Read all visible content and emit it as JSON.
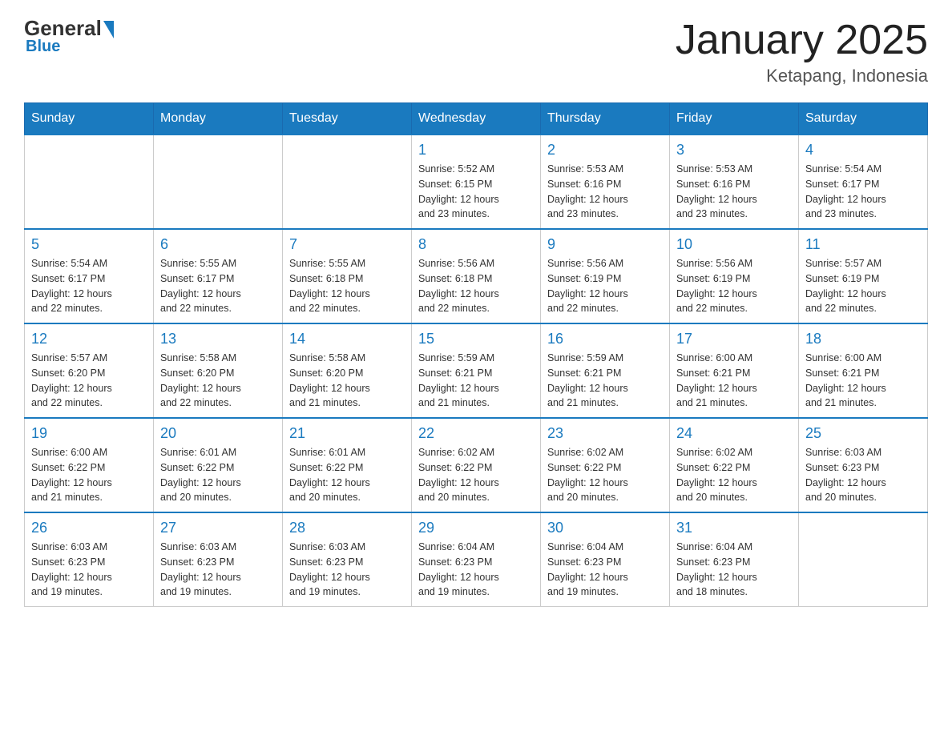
{
  "header": {
    "logo": {
      "text_general": "General",
      "text_blue": "Blue"
    },
    "title": "January 2025",
    "location": "Ketapang, Indonesia"
  },
  "weekdays": [
    "Sunday",
    "Monday",
    "Tuesday",
    "Wednesday",
    "Thursday",
    "Friday",
    "Saturday"
  ],
  "weeks": [
    [
      {
        "day": "",
        "info": ""
      },
      {
        "day": "",
        "info": ""
      },
      {
        "day": "",
        "info": ""
      },
      {
        "day": "1",
        "info": "Sunrise: 5:52 AM\nSunset: 6:15 PM\nDaylight: 12 hours\nand 23 minutes."
      },
      {
        "day": "2",
        "info": "Sunrise: 5:53 AM\nSunset: 6:16 PM\nDaylight: 12 hours\nand 23 minutes."
      },
      {
        "day": "3",
        "info": "Sunrise: 5:53 AM\nSunset: 6:16 PM\nDaylight: 12 hours\nand 23 minutes."
      },
      {
        "day": "4",
        "info": "Sunrise: 5:54 AM\nSunset: 6:17 PM\nDaylight: 12 hours\nand 23 minutes."
      }
    ],
    [
      {
        "day": "5",
        "info": "Sunrise: 5:54 AM\nSunset: 6:17 PM\nDaylight: 12 hours\nand 22 minutes."
      },
      {
        "day": "6",
        "info": "Sunrise: 5:55 AM\nSunset: 6:17 PM\nDaylight: 12 hours\nand 22 minutes."
      },
      {
        "day": "7",
        "info": "Sunrise: 5:55 AM\nSunset: 6:18 PM\nDaylight: 12 hours\nand 22 minutes."
      },
      {
        "day": "8",
        "info": "Sunrise: 5:56 AM\nSunset: 6:18 PM\nDaylight: 12 hours\nand 22 minutes."
      },
      {
        "day": "9",
        "info": "Sunrise: 5:56 AM\nSunset: 6:19 PM\nDaylight: 12 hours\nand 22 minutes."
      },
      {
        "day": "10",
        "info": "Sunrise: 5:56 AM\nSunset: 6:19 PM\nDaylight: 12 hours\nand 22 minutes."
      },
      {
        "day": "11",
        "info": "Sunrise: 5:57 AM\nSunset: 6:19 PM\nDaylight: 12 hours\nand 22 minutes."
      }
    ],
    [
      {
        "day": "12",
        "info": "Sunrise: 5:57 AM\nSunset: 6:20 PM\nDaylight: 12 hours\nand 22 minutes."
      },
      {
        "day": "13",
        "info": "Sunrise: 5:58 AM\nSunset: 6:20 PM\nDaylight: 12 hours\nand 22 minutes."
      },
      {
        "day": "14",
        "info": "Sunrise: 5:58 AM\nSunset: 6:20 PM\nDaylight: 12 hours\nand 21 minutes."
      },
      {
        "day": "15",
        "info": "Sunrise: 5:59 AM\nSunset: 6:21 PM\nDaylight: 12 hours\nand 21 minutes."
      },
      {
        "day": "16",
        "info": "Sunrise: 5:59 AM\nSunset: 6:21 PM\nDaylight: 12 hours\nand 21 minutes."
      },
      {
        "day": "17",
        "info": "Sunrise: 6:00 AM\nSunset: 6:21 PM\nDaylight: 12 hours\nand 21 minutes."
      },
      {
        "day": "18",
        "info": "Sunrise: 6:00 AM\nSunset: 6:21 PM\nDaylight: 12 hours\nand 21 minutes."
      }
    ],
    [
      {
        "day": "19",
        "info": "Sunrise: 6:00 AM\nSunset: 6:22 PM\nDaylight: 12 hours\nand 21 minutes."
      },
      {
        "day": "20",
        "info": "Sunrise: 6:01 AM\nSunset: 6:22 PM\nDaylight: 12 hours\nand 20 minutes."
      },
      {
        "day": "21",
        "info": "Sunrise: 6:01 AM\nSunset: 6:22 PM\nDaylight: 12 hours\nand 20 minutes."
      },
      {
        "day": "22",
        "info": "Sunrise: 6:02 AM\nSunset: 6:22 PM\nDaylight: 12 hours\nand 20 minutes."
      },
      {
        "day": "23",
        "info": "Sunrise: 6:02 AM\nSunset: 6:22 PM\nDaylight: 12 hours\nand 20 minutes."
      },
      {
        "day": "24",
        "info": "Sunrise: 6:02 AM\nSunset: 6:22 PM\nDaylight: 12 hours\nand 20 minutes."
      },
      {
        "day": "25",
        "info": "Sunrise: 6:03 AM\nSunset: 6:23 PM\nDaylight: 12 hours\nand 20 minutes."
      }
    ],
    [
      {
        "day": "26",
        "info": "Sunrise: 6:03 AM\nSunset: 6:23 PM\nDaylight: 12 hours\nand 19 minutes."
      },
      {
        "day": "27",
        "info": "Sunrise: 6:03 AM\nSunset: 6:23 PM\nDaylight: 12 hours\nand 19 minutes."
      },
      {
        "day": "28",
        "info": "Sunrise: 6:03 AM\nSunset: 6:23 PM\nDaylight: 12 hours\nand 19 minutes."
      },
      {
        "day": "29",
        "info": "Sunrise: 6:04 AM\nSunset: 6:23 PM\nDaylight: 12 hours\nand 19 minutes."
      },
      {
        "day": "30",
        "info": "Sunrise: 6:04 AM\nSunset: 6:23 PM\nDaylight: 12 hours\nand 19 minutes."
      },
      {
        "day": "31",
        "info": "Sunrise: 6:04 AM\nSunset: 6:23 PM\nDaylight: 12 hours\nand 18 minutes."
      },
      {
        "day": "",
        "info": ""
      }
    ]
  ]
}
